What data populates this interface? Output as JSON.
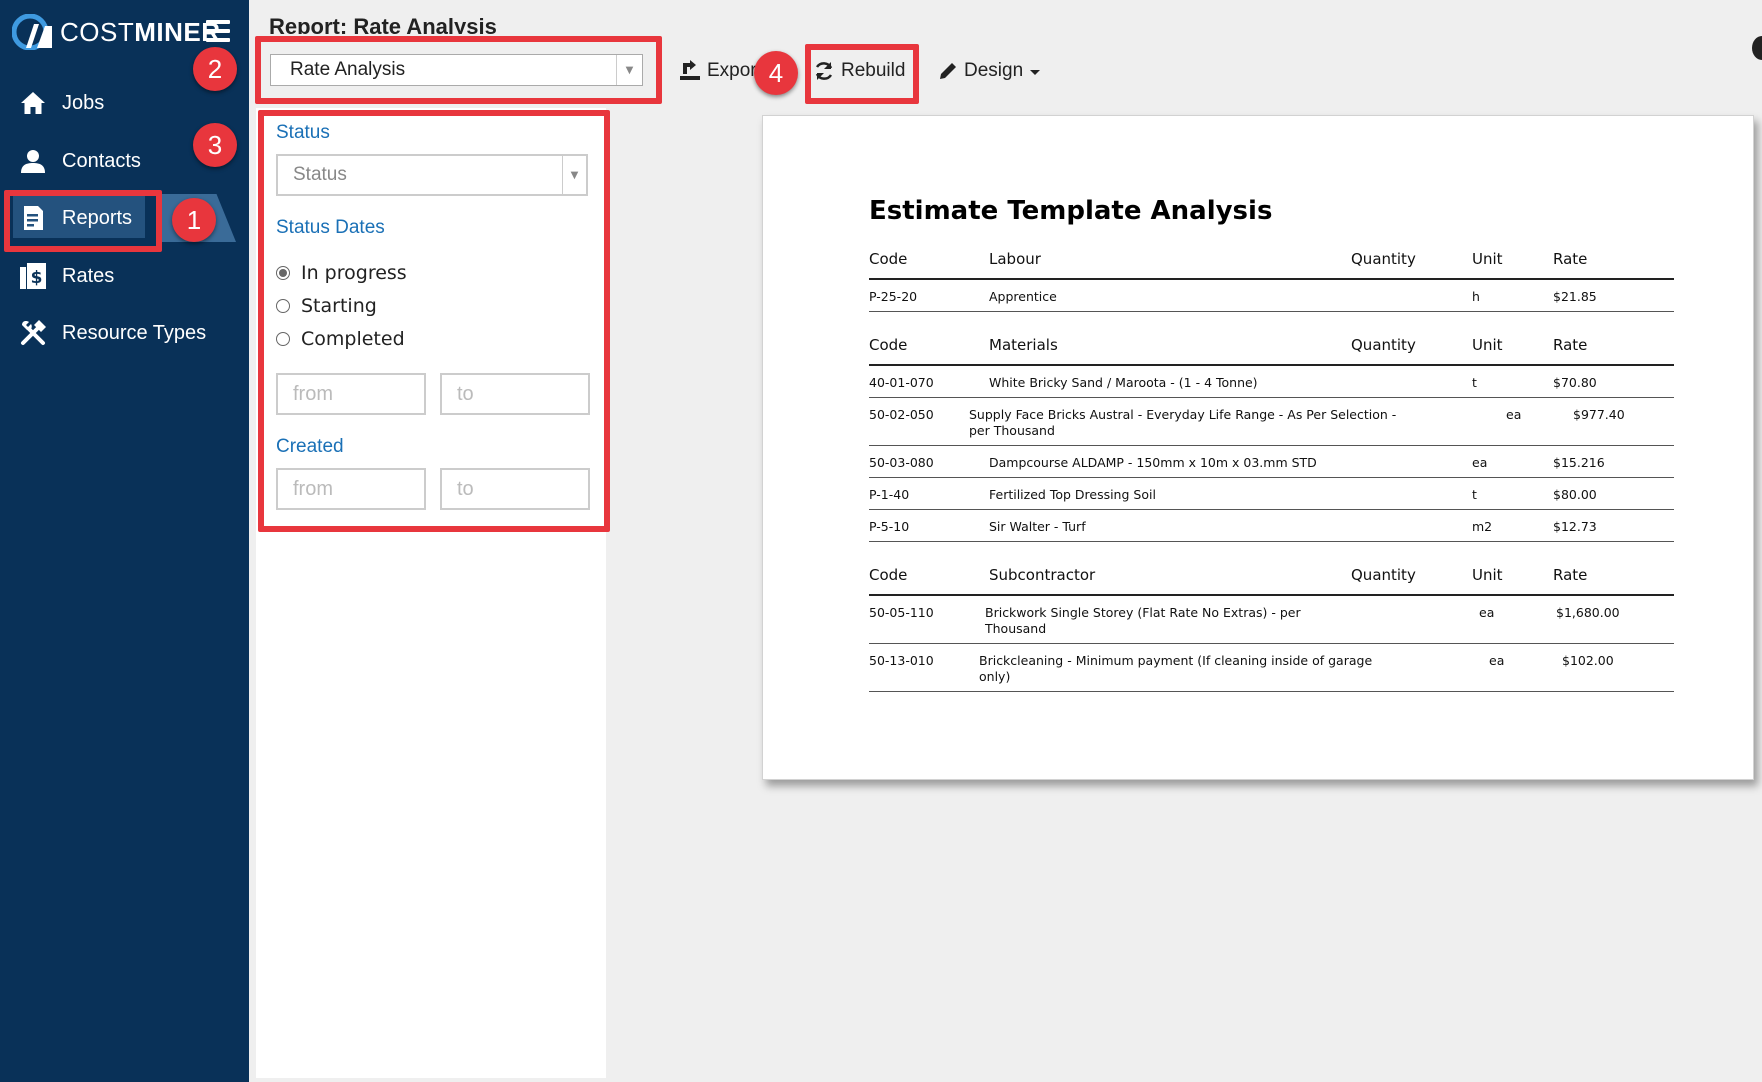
{
  "brand": {
    "name_light": "COST",
    "name_bold": "MINER"
  },
  "sidebar": {
    "items": [
      {
        "label": "Jobs",
        "icon": "home-icon"
      },
      {
        "label": "Contacts",
        "icon": "person-icon"
      },
      {
        "label": "Reports",
        "icon": "report-icon",
        "active": true
      },
      {
        "label": "Rates",
        "icon": "dollar-book-icon"
      },
      {
        "label": "Resource Types",
        "icon": "tools-icon"
      }
    ]
  },
  "header": {
    "title": "Report: Rate Analysis",
    "report_select": "Rate Analysis",
    "export_label": "Export",
    "rebuild_label": "Rebuild",
    "design_label": "Design"
  },
  "filters": {
    "status_label": "Status",
    "status_placeholder": "Status",
    "status_dates_label": "Status Dates",
    "radios": [
      "In progress",
      "Starting",
      "Completed"
    ],
    "selected_radio": "In progress",
    "from_placeholder": "from",
    "to_placeholder": "to",
    "created_label": "Created"
  },
  "annotations": [
    "1",
    "2",
    "3",
    "4"
  ],
  "report": {
    "title": "Estimate Template Analysis",
    "col_code": "Code",
    "col_quantity": "Quantity",
    "col_unit": "Unit",
    "col_rate": "Rate",
    "sections": [
      {
        "name": "Labour",
        "rows": [
          {
            "code": "P-25-20",
            "desc": "Apprentice",
            "unit": "h",
            "rate": "$21.85"
          }
        ]
      },
      {
        "name": "Materials",
        "rows": [
          {
            "code": "40-01-070",
            "desc": "White Bricky Sand / Maroota - (1 - 4 Tonne)",
            "unit": "t",
            "rate": "$70.80"
          },
          {
            "code": "50-02-050",
            "desc": "Supply Face Bricks Austral - Everyday Life Range - As Per Selection - per Thousand",
            "unit": "ea",
            "rate": "$977.40"
          },
          {
            "code": "50-03-080",
            "desc": "Dampcourse ALDAMP - 150mm x 10m x 03.mm STD",
            "unit": "ea",
            "rate": "$15.216"
          },
          {
            "code": "P-1-40",
            "desc": "Fertilized Top Dressing Soil",
            "unit": "t",
            "rate": "$80.00"
          },
          {
            "code": "P-5-10",
            "desc": "Sir Walter - Turf",
            "unit": "m2",
            "rate": "$12.73"
          }
        ]
      },
      {
        "name": "Subcontractor",
        "rows": [
          {
            "code": "50-05-110",
            "desc": "Brickwork Single Storey (Flat Rate No Extras) - per Thousand",
            "unit": "ea",
            "rate": "$1,680.00"
          },
          {
            "code": "50-13-010",
            "desc": "Brickcleaning - Minimum payment (If cleaning inside of garage only)",
            "unit": "ea",
            "rate": "$102.00"
          }
        ]
      }
    ]
  }
}
